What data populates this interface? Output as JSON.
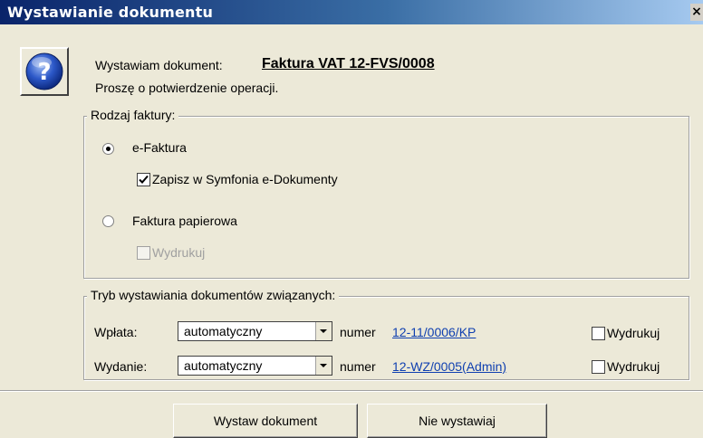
{
  "window": {
    "title": "Wystawianie dokumentu",
    "close_label": "×"
  },
  "icon": {
    "name": "question-icon",
    "glyph": "?"
  },
  "header": {
    "issuing_label": "Wystawiam dokument:",
    "document_name": "Faktura VAT 12-FVS/0008",
    "confirm_text": "Proszę o potwierdzenie operacji."
  },
  "invoice_type": {
    "legend": "Rodzaj faktury:",
    "options": [
      {
        "label": "e-Faktura",
        "selected": true
      },
      {
        "label": "Faktura papierowa",
        "selected": false
      }
    ],
    "save_edocs": {
      "label": "Zapisz w Symfonia e-Dokumenty",
      "checked": true
    },
    "print_paper": {
      "label": "Wydrukuj",
      "checked": false,
      "disabled": true
    }
  },
  "related_docs": {
    "legend": "Tryb wystawiania dokumentów związanych:",
    "rows": [
      {
        "label": "Wpłata:",
        "mode": "automatyczny",
        "number_label": "numer",
        "number": "12-11/0006/KP",
        "print_label": "Wydrukuj",
        "print_checked": false
      },
      {
        "label": "Wydanie:",
        "mode": "automatyczny",
        "number_label": "numer",
        "number": "12-WZ/0005(Admin)",
        "print_label": "Wydrukuj",
        "print_checked": false
      }
    ]
  },
  "buttons": {
    "issue": "Wystaw dokument",
    "cancel": "Nie wystawiaj"
  },
  "colors": {
    "title_start": "#0a246a",
    "title_end": "#a6caf0",
    "link": "#1040b0",
    "dialog_bg": "#ece9d8"
  }
}
